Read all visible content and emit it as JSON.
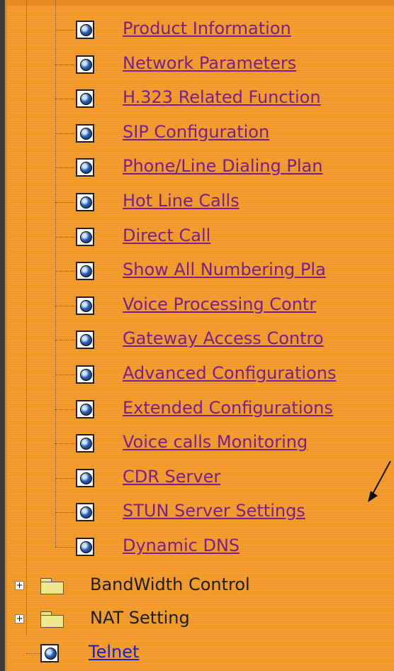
{
  "tree": {
    "sub_items": [
      "Product Information",
      "Network Parameters",
      "H.323 Related Function",
      "SIP Configuration",
      "Phone/Line Dialing Plan",
      "Hot Line Calls",
      "Direct Call",
      "Show All Numbering Pla",
      "Voice Processing Contr",
      "Gateway Access Contro",
      "Advanced Configurations",
      "Extended Configurations",
      "Voice calls Monitoring",
      "CDR Server",
      "STUN Server Settings",
      "Dynamic DNS"
    ],
    "folders": [
      "BandWidth Control",
      "NAT Setting"
    ],
    "telnet": "Telnet",
    "expander_symbol": "+"
  },
  "colors": {
    "background": "#f59e2e",
    "visited_link": "#7a1f8f",
    "link": "#1322d6"
  },
  "icons": {
    "page": "page-globe-icon",
    "folder": "folder-icon",
    "expander": "expand-plus-icon",
    "annotation": "arrow-icon"
  }
}
